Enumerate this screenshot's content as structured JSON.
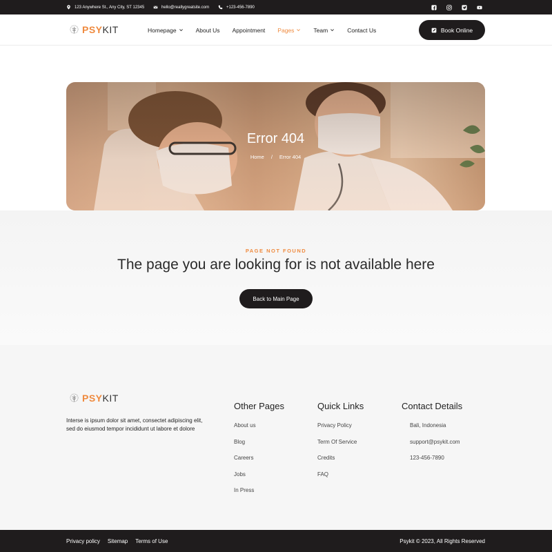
{
  "topbar": {
    "address": "123 Anywhere St., Any City, ST 12345",
    "email": "hello@reallygreatsite.com",
    "phone": "+123-456-7890"
  },
  "brand": {
    "part1": "PSY",
    "part2": "KIT"
  },
  "nav": {
    "homepage": "Homepage",
    "about": "About Us",
    "appointment": "Appointment",
    "pages": "Pages",
    "team": "Team",
    "contact": "Contact Us"
  },
  "book_button": "Book Online",
  "hero": {
    "title": "Error 404",
    "crumb_home": "Home",
    "crumb_sep": "/",
    "crumb_current": "Error 404"
  },
  "not_found": {
    "label": "PAGE NOT FOUND",
    "headline": "The page you are looking for is not available here",
    "button": "Back to Main Page"
  },
  "footer": {
    "about": "Interse is ipsum dolor sit amet, consectet adipiscing elit, sed do eiusmod tempor incididunt ut labore et dolore",
    "other_pages": {
      "title": "Other Pages",
      "links": [
        "About us",
        "Blog",
        "Careers",
        "Jobs",
        "In Press"
      ]
    },
    "quick_links": {
      "title": "Quick Links",
      "links": [
        "Privacy Policy",
        "Term Of Service",
        "Credits",
        "FAQ"
      ]
    },
    "contact": {
      "title": "Contact Details",
      "items": [
        "Bali, Indonesia",
        "support@psykit.com",
        "123-456-7890"
      ]
    }
  },
  "bottom": {
    "privacy": "Privacy policy",
    "sitemap": "Sitemap",
    "terms": "Terms of Use",
    "copyright": "Psykit © 2023, All Rights Reserved"
  },
  "colors": {
    "accent": "#ef8a3e",
    "dark": "#1f1c1d"
  }
}
